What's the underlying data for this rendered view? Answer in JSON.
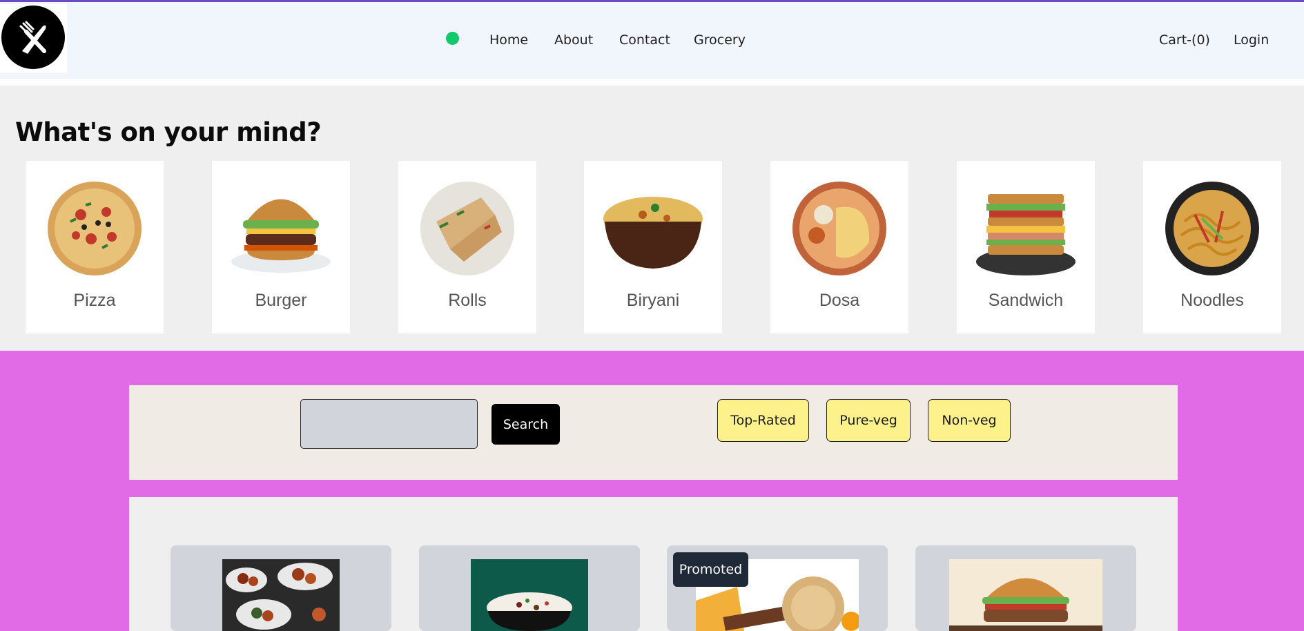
{
  "header": {
    "nav": [
      {
        "label": "Home"
      },
      {
        "label": "About"
      },
      {
        "label": "Contact"
      },
      {
        "label": "Grocery"
      }
    ],
    "cart_label": "Cart-(0)",
    "login_label": "Login",
    "status_color": "#10c96b"
  },
  "mind": {
    "title": "What's on your mind?",
    "categories": [
      {
        "label": "Pizza",
        "icon": "pizza-image"
      },
      {
        "label": "Burger",
        "icon": "burger-image"
      },
      {
        "label": "Rolls",
        "icon": "rolls-image"
      },
      {
        "label": "Biryani",
        "icon": "biryani-image"
      },
      {
        "label": "Dosa",
        "icon": "dosa-image"
      },
      {
        "label": "Sandwich",
        "icon": "sandwich-image"
      },
      {
        "label": "Noodles",
        "icon": "noodles-image"
      }
    ]
  },
  "filters": {
    "search_value": "",
    "search_label": "Search",
    "buttons": [
      {
        "label": "Top-Rated"
      },
      {
        "label": "Pure-veg"
      },
      {
        "label": "Non-veg"
      }
    ]
  },
  "restaurants": [
    {
      "image": "wings-platter-image"
    },
    {
      "image": "rice-bowl-image"
    },
    {
      "image": "cheese-image",
      "badge": "Promoted"
    },
    {
      "image": "burger-photo-image"
    }
  ],
  "colors": {
    "accent_pink": "#e16be6",
    "filter_yellow": "#fcf18b",
    "header_bg": "#f1f6fd"
  }
}
